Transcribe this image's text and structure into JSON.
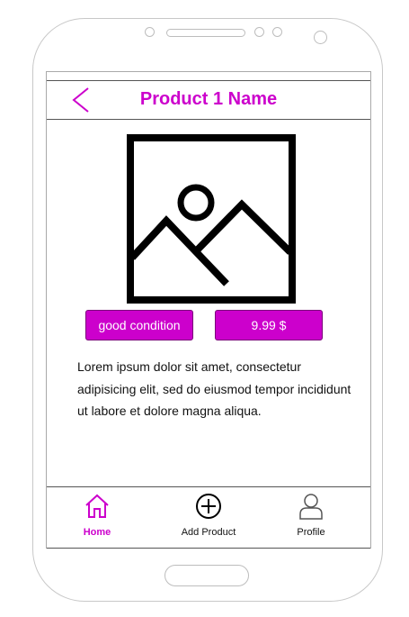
{
  "header": {
    "title": "Product 1 Name"
  },
  "product": {
    "condition": "good condition",
    "price": "9.99 $",
    "description": "Lorem ipsum dolor sit amet, consectetur adipisicing elit, sed do eiusmod tempor incididunt ut labore et dolore magna aliqua."
  },
  "tabs": [
    {
      "label": "Home",
      "icon": "home-icon",
      "active": true
    },
    {
      "label": "Add Product",
      "icon": "plus-circle-icon",
      "active": false
    },
    {
      "label": "Profile",
      "icon": "user-icon",
      "active": false
    }
  ],
  "colors": {
    "accent": "#cc00cc"
  }
}
